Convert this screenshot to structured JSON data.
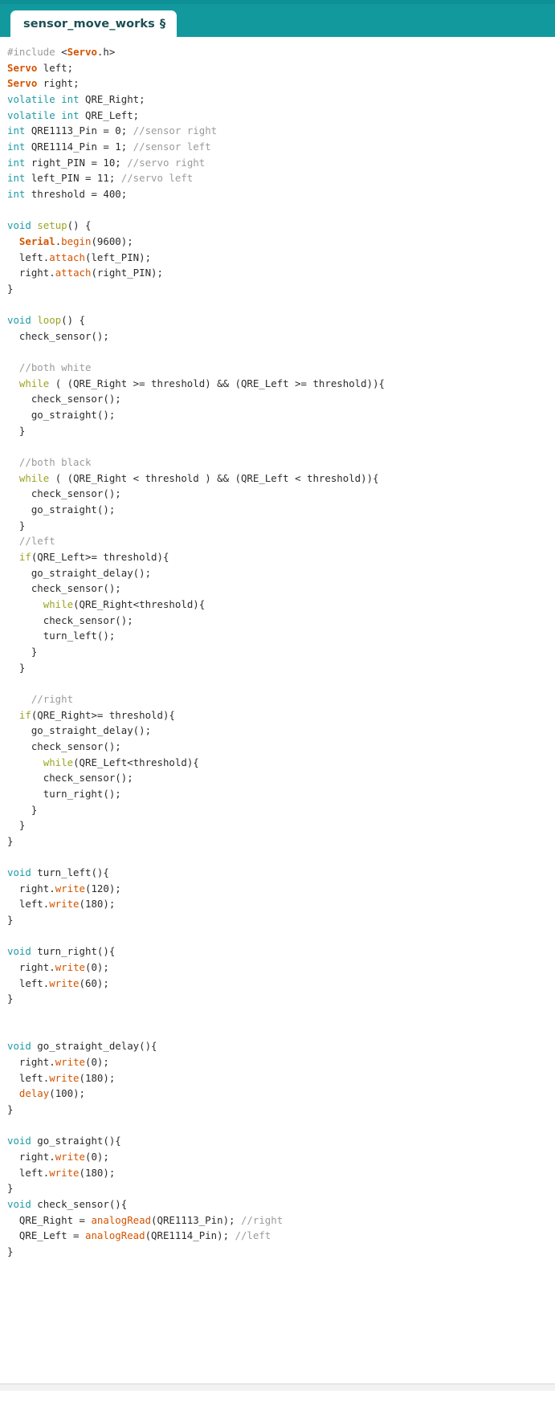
{
  "window": {
    "accent_color": "#12999e",
    "top_bar_color": "#0d9197",
    "background": "#ffffff"
  },
  "tab": {
    "label": "sensor_move_works",
    "modified_marker": "§"
  },
  "editor": {
    "language": "arduino",
    "colors": {
      "keyword": "#1f9ba5",
      "keyword_alt": "#9ba521",
      "type": "#d35400",
      "function": "#d35400",
      "comment": "#9b9b9b",
      "plain": "#2b2b2b"
    },
    "lines": [
      {
        "tokens": [
          {
            "t": "#include ",
            "c": "pre"
          },
          {
            "t": "<",
            "c": "pln"
          },
          {
            "t": "Servo",
            "c": "typ"
          },
          {
            "t": ".h>",
            "c": "pln"
          }
        ]
      },
      {
        "tokens": [
          {
            "t": "Servo",
            "c": "typ"
          },
          {
            "t": " left;",
            "c": "pln"
          }
        ]
      },
      {
        "tokens": [
          {
            "t": "Servo",
            "c": "typ"
          },
          {
            "t": " right;",
            "c": "pln"
          }
        ]
      },
      {
        "tokens": [
          {
            "t": "volatile",
            "c": "kw"
          },
          {
            "t": " ",
            "c": "pln"
          },
          {
            "t": "int",
            "c": "kw"
          },
          {
            "t": " QRE_Right;",
            "c": "pln"
          }
        ]
      },
      {
        "tokens": [
          {
            "t": "volatile",
            "c": "kw"
          },
          {
            "t": " ",
            "c": "pln"
          },
          {
            "t": "int",
            "c": "kw"
          },
          {
            "t": " QRE_Left;",
            "c": "pln"
          }
        ]
      },
      {
        "tokens": [
          {
            "t": "int",
            "c": "kw"
          },
          {
            "t": " QRE1113_Pin = 0; ",
            "c": "pln"
          },
          {
            "t": "//sensor right",
            "c": "com"
          }
        ]
      },
      {
        "tokens": [
          {
            "t": "int",
            "c": "kw"
          },
          {
            "t": " QRE1114_Pin = 1; ",
            "c": "pln"
          },
          {
            "t": "//sensor left",
            "c": "com"
          }
        ]
      },
      {
        "tokens": [
          {
            "t": "int",
            "c": "kw"
          },
          {
            "t": " right_PIN = 10; ",
            "c": "pln"
          },
          {
            "t": "//servo right",
            "c": "com"
          }
        ]
      },
      {
        "tokens": [
          {
            "t": "int",
            "c": "kw"
          },
          {
            "t": " left_PIN = 11; ",
            "c": "pln"
          },
          {
            "t": "//servo left",
            "c": "com"
          }
        ]
      },
      {
        "tokens": [
          {
            "t": "int",
            "c": "kw"
          },
          {
            "t": " threshold = 400;",
            "c": "pln"
          }
        ]
      },
      {
        "tokens": []
      },
      {
        "tokens": [
          {
            "t": "void",
            "c": "kw"
          },
          {
            "t": " ",
            "c": "pln"
          },
          {
            "t": "setup",
            "c": "kw2"
          },
          {
            "t": "() {",
            "c": "pln"
          }
        ]
      },
      {
        "tokens": [
          {
            "t": "  ",
            "c": "pln"
          },
          {
            "t": "Serial",
            "c": "typ"
          },
          {
            "t": ".",
            "c": "pln"
          },
          {
            "t": "begin",
            "c": "fn"
          },
          {
            "t": "(9600);",
            "c": "pln"
          }
        ]
      },
      {
        "tokens": [
          {
            "t": "  left.",
            "c": "pln"
          },
          {
            "t": "attach",
            "c": "fn"
          },
          {
            "t": "(left_PIN);",
            "c": "pln"
          }
        ]
      },
      {
        "tokens": [
          {
            "t": "  right.",
            "c": "pln"
          },
          {
            "t": "attach",
            "c": "fn"
          },
          {
            "t": "(right_PIN);",
            "c": "pln"
          }
        ]
      },
      {
        "tokens": [
          {
            "t": "}",
            "c": "pln"
          }
        ]
      },
      {
        "tokens": []
      },
      {
        "tokens": [
          {
            "t": "void",
            "c": "kw"
          },
          {
            "t": " ",
            "c": "pln"
          },
          {
            "t": "loop",
            "c": "kw2"
          },
          {
            "t": "() {",
            "c": "pln"
          }
        ]
      },
      {
        "tokens": [
          {
            "t": "  check_sensor();",
            "c": "pln"
          }
        ]
      },
      {
        "tokens": []
      },
      {
        "tokens": [
          {
            "t": "  ",
            "c": "pln"
          },
          {
            "t": "//both white",
            "c": "com"
          }
        ]
      },
      {
        "tokens": [
          {
            "t": "  ",
            "c": "pln"
          },
          {
            "t": "while",
            "c": "kw2"
          },
          {
            "t": " ( (QRE_Right >= threshold) && (QRE_Left >= threshold)){",
            "c": "pln"
          }
        ]
      },
      {
        "tokens": [
          {
            "t": "    check_sensor();",
            "c": "pln"
          }
        ]
      },
      {
        "tokens": [
          {
            "t": "    go_straight();",
            "c": "pln"
          }
        ]
      },
      {
        "tokens": [
          {
            "t": "  }",
            "c": "pln"
          }
        ]
      },
      {
        "tokens": []
      },
      {
        "tokens": [
          {
            "t": "  ",
            "c": "pln"
          },
          {
            "t": "//both black",
            "c": "com"
          }
        ]
      },
      {
        "tokens": [
          {
            "t": "  ",
            "c": "pln"
          },
          {
            "t": "while",
            "c": "kw2"
          },
          {
            "t": " ( (QRE_Right < threshold ) && (QRE_Left < threshold)){",
            "c": "pln"
          }
        ]
      },
      {
        "tokens": [
          {
            "t": "    check_sensor();",
            "c": "pln"
          }
        ]
      },
      {
        "tokens": [
          {
            "t": "    go_straight();",
            "c": "pln"
          }
        ]
      },
      {
        "tokens": [
          {
            "t": "  }",
            "c": "pln"
          }
        ]
      },
      {
        "tokens": [
          {
            "t": "  ",
            "c": "pln"
          },
          {
            "t": "//left",
            "c": "com"
          }
        ]
      },
      {
        "tokens": [
          {
            "t": "  ",
            "c": "pln"
          },
          {
            "t": "if",
            "c": "kw2"
          },
          {
            "t": "(QRE_Left>= threshold){",
            "c": "pln"
          }
        ]
      },
      {
        "tokens": [
          {
            "t": "    go_straight_delay();",
            "c": "pln"
          }
        ]
      },
      {
        "tokens": [
          {
            "t": "    check_sensor();",
            "c": "pln"
          }
        ]
      },
      {
        "tokens": [
          {
            "t": "      ",
            "c": "pln"
          },
          {
            "t": "while",
            "c": "kw2"
          },
          {
            "t": "(QRE_Right<threshold){",
            "c": "pln"
          }
        ]
      },
      {
        "tokens": [
          {
            "t": "      check_sensor();",
            "c": "pln"
          }
        ]
      },
      {
        "tokens": [
          {
            "t": "      turn_left();",
            "c": "pln"
          }
        ]
      },
      {
        "tokens": [
          {
            "t": "    }",
            "c": "pln"
          }
        ]
      },
      {
        "tokens": [
          {
            "t": "  }",
            "c": "pln"
          }
        ]
      },
      {
        "tokens": []
      },
      {
        "tokens": [
          {
            "t": "    ",
            "c": "pln"
          },
          {
            "t": "//right",
            "c": "com"
          }
        ]
      },
      {
        "tokens": [
          {
            "t": "  ",
            "c": "pln"
          },
          {
            "t": "if",
            "c": "kw2"
          },
          {
            "t": "(QRE_Right>= threshold){",
            "c": "pln"
          }
        ]
      },
      {
        "tokens": [
          {
            "t": "    go_straight_delay();",
            "c": "pln"
          }
        ]
      },
      {
        "tokens": [
          {
            "t": "    check_sensor();",
            "c": "pln"
          }
        ]
      },
      {
        "tokens": [
          {
            "t": "      ",
            "c": "pln"
          },
          {
            "t": "while",
            "c": "kw2"
          },
          {
            "t": "(QRE_Left<threshold){",
            "c": "pln"
          }
        ]
      },
      {
        "tokens": [
          {
            "t": "      check_sensor();",
            "c": "pln"
          }
        ]
      },
      {
        "tokens": [
          {
            "t": "      turn_right();",
            "c": "pln"
          }
        ]
      },
      {
        "tokens": [
          {
            "t": "    }",
            "c": "pln"
          }
        ]
      },
      {
        "tokens": [
          {
            "t": "  }",
            "c": "pln"
          }
        ]
      },
      {
        "tokens": [
          {
            "t": "}",
            "c": "pln"
          }
        ]
      },
      {
        "tokens": []
      },
      {
        "tokens": [
          {
            "t": "void",
            "c": "kw"
          },
          {
            "t": " turn_left(){",
            "c": "pln"
          }
        ]
      },
      {
        "tokens": [
          {
            "t": "  right.",
            "c": "pln"
          },
          {
            "t": "write",
            "c": "fn"
          },
          {
            "t": "(120);",
            "c": "pln"
          }
        ]
      },
      {
        "tokens": [
          {
            "t": "  left.",
            "c": "pln"
          },
          {
            "t": "write",
            "c": "fn"
          },
          {
            "t": "(180);",
            "c": "pln"
          }
        ]
      },
      {
        "tokens": [
          {
            "t": "}",
            "c": "pln"
          }
        ]
      },
      {
        "tokens": []
      },
      {
        "tokens": [
          {
            "t": "void",
            "c": "kw"
          },
          {
            "t": " turn_right(){",
            "c": "pln"
          }
        ]
      },
      {
        "tokens": [
          {
            "t": "  right.",
            "c": "pln"
          },
          {
            "t": "write",
            "c": "fn"
          },
          {
            "t": "(0);",
            "c": "pln"
          }
        ]
      },
      {
        "tokens": [
          {
            "t": "  left.",
            "c": "pln"
          },
          {
            "t": "write",
            "c": "fn"
          },
          {
            "t": "(60);",
            "c": "pln"
          }
        ]
      },
      {
        "tokens": [
          {
            "t": "}",
            "c": "pln"
          }
        ]
      },
      {
        "tokens": []
      },
      {
        "tokens": []
      },
      {
        "tokens": [
          {
            "t": "void",
            "c": "kw"
          },
          {
            "t": " go_straight_delay(){",
            "c": "pln"
          }
        ]
      },
      {
        "tokens": [
          {
            "t": "  right.",
            "c": "pln"
          },
          {
            "t": "write",
            "c": "fn"
          },
          {
            "t": "(0);",
            "c": "pln"
          }
        ]
      },
      {
        "tokens": [
          {
            "t": "  left.",
            "c": "pln"
          },
          {
            "t": "write",
            "c": "fn"
          },
          {
            "t": "(180);",
            "c": "pln"
          }
        ]
      },
      {
        "tokens": [
          {
            "t": "  ",
            "c": "pln"
          },
          {
            "t": "delay",
            "c": "fn"
          },
          {
            "t": "(100);",
            "c": "pln"
          }
        ]
      },
      {
        "tokens": [
          {
            "t": "}",
            "c": "pln"
          }
        ]
      },
      {
        "tokens": []
      },
      {
        "tokens": [
          {
            "t": "void",
            "c": "kw"
          },
          {
            "t": " go_straight(){",
            "c": "pln"
          }
        ]
      },
      {
        "tokens": [
          {
            "t": "  right.",
            "c": "pln"
          },
          {
            "t": "write",
            "c": "fn"
          },
          {
            "t": "(0);",
            "c": "pln"
          }
        ]
      },
      {
        "tokens": [
          {
            "t": "  left.",
            "c": "pln"
          },
          {
            "t": "write",
            "c": "fn"
          },
          {
            "t": "(180);",
            "c": "pln"
          }
        ]
      },
      {
        "tokens": [
          {
            "t": "}",
            "c": "pln"
          }
        ]
      },
      {
        "tokens": [
          {
            "t": "void",
            "c": "kw"
          },
          {
            "t": " check_sensor(){",
            "c": "pln"
          }
        ]
      },
      {
        "tokens": [
          {
            "t": "  QRE_Right = ",
            "c": "pln"
          },
          {
            "t": "analogRead",
            "c": "fn"
          },
          {
            "t": "(QRE1113_Pin); ",
            "c": "pln"
          },
          {
            "t": "//right",
            "c": "com"
          }
        ]
      },
      {
        "tokens": [
          {
            "t": "  QRE_Left = ",
            "c": "pln"
          },
          {
            "t": "analogRead",
            "c": "fn"
          },
          {
            "t": "(QRE1114_Pin); ",
            "c": "pln"
          },
          {
            "t": "//left",
            "c": "com"
          }
        ]
      },
      {
        "tokens": [
          {
            "t": "}",
            "c": "pln"
          }
        ]
      }
    ]
  }
}
